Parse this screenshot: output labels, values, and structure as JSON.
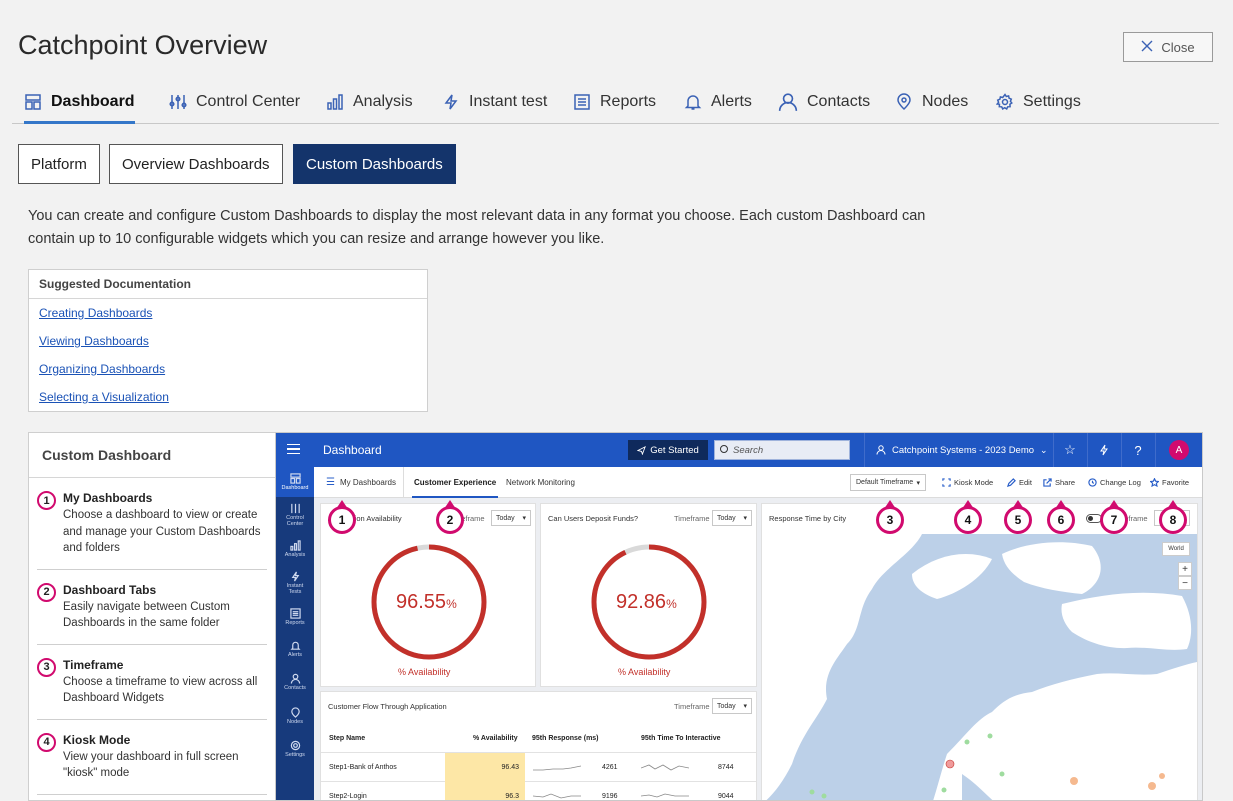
{
  "page": {
    "title": "Catchpoint Overview",
    "close_label": "Close"
  },
  "nav": {
    "tabs": [
      {
        "label": "Dashboard",
        "icon": "dashboard-icon",
        "active": true
      },
      {
        "label": "Control Center",
        "icon": "sliders-icon"
      },
      {
        "label": "Analysis",
        "icon": "bar-chart-icon"
      },
      {
        "label": "Instant test",
        "icon": "lightning-icon"
      },
      {
        "label": "Reports",
        "icon": "report-icon"
      },
      {
        "label": "Alerts",
        "icon": "bell-icon"
      },
      {
        "label": "Contacts",
        "icon": "person-icon"
      },
      {
        "label": "Nodes",
        "icon": "location-pin-icon"
      },
      {
        "label": "Settings",
        "icon": "gear-icon"
      }
    ]
  },
  "segments": [
    {
      "label": "Platform"
    },
    {
      "label": "Overview Dashboards"
    },
    {
      "label": "Custom Dashboards",
      "active": true
    }
  ],
  "description": "You can create and configure Custom Dashboards to display the most relevant data in any format you choose. Each custom Dashboard can contain up to 10 configurable widgets which you can resize and arrange however you like.",
  "docs": {
    "heading": "Suggested Documentation",
    "links": [
      "Creating Dashboards",
      "Viewing Dashboards",
      "Organizing Dashboards",
      "Selecting a Visualization"
    ]
  },
  "legend": {
    "heading": "Custom Dashboard",
    "items": [
      {
        "num": "1",
        "title": "My Dashboards",
        "desc": "Choose a dashboard to view or create and manage your Custom Dashboards and folders"
      },
      {
        "num": "2",
        "title": "Dashboard Tabs",
        "desc": "Easily navigate between Custom Dashboards in the same folder"
      },
      {
        "num": "3",
        "title": "Timeframe",
        "desc": "Choose a timeframe to view across all Dashboard Widgets"
      },
      {
        "num": "4",
        "title": "Kiosk Mode",
        "desc": "View your dashboard in full screen \"kiosk\" mode"
      }
    ]
  },
  "app": {
    "topbar": {
      "title": "Dashboard",
      "get_started": "Get Started",
      "search_placeholder": "Search",
      "org": "Catchpoint Systems - 2023 Demo",
      "avatar": "A"
    },
    "sidenav": [
      "Dashboard",
      "Control Center",
      "Analysis",
      "Instant Tests",
      "Reports",
      "Alerts",
      "Contacts",
      "Nodes",
      "Settings"
    ],
    "subbar": {
      "my_dashboards": "My Dashboards",
      "tabs": [
        "Customer Experience",
        "Network Monitoring"
      ],
      "timeframe": "Default Timeframe",
      "actions": [
        "Kiosk Mode",
        "Edit",
        "Share",
        "Change Log",
        "Favorite"
      ]
    },
    "widgets": {
      "w1": {
        "title": "Application Availability",
        "timeframe_label": "Timeframe",
        "timeframe": "Today",
        "value": "96.55",
        "unit": "%",
        "label": "% Availability",
        "fraction": 0.9655
      },
      "w2": {
        "title": "Can Users Deposit Funds?",
        "timeframe_label": "Timeframe",
        "timeframe": "Today",
        "value": "92.86",
        "unit": "%",
        "label": "% Availability",
        "fraction": 0.9286
      },
      "map": {
        "title": "Response Time by City",
        "timeframe_label": "Timeframe",
        "world_btn": "World",
        "zoom_in": "+",
        "zoom_out": "−"
      },
      "flow": {
        "title": "Customer Flow Through Application",
        "timeframe_label": "Timeframe",
        "timeframe": "Today",
        "headers": [
          "Step Name",
          "% Availability",
          "95th Response (ms)",
          "95th Time To Interactive"
        ],
        "rows": [
          [
            "Step1-Bank of Anthos",
            "96.43",
            "4261",
            "8744"
          ],
          [
            "Step2-Login",
            "96.3",
            "9196",
            "9044"
          ]
        ]
      }
    },
    "markers": [
      "1",
      "2",
      "3",
      "4",
      "5",
      "6",
      "7",
      "8"
    ]
  },
  "colors": {
    "accent": "#1f56c2",
    "dark_nav": "#173a7c",
    "marker": "#d10a6e",
    "gauge": "#c2302a",
    "active_segment": "#14346b"
  }
}
